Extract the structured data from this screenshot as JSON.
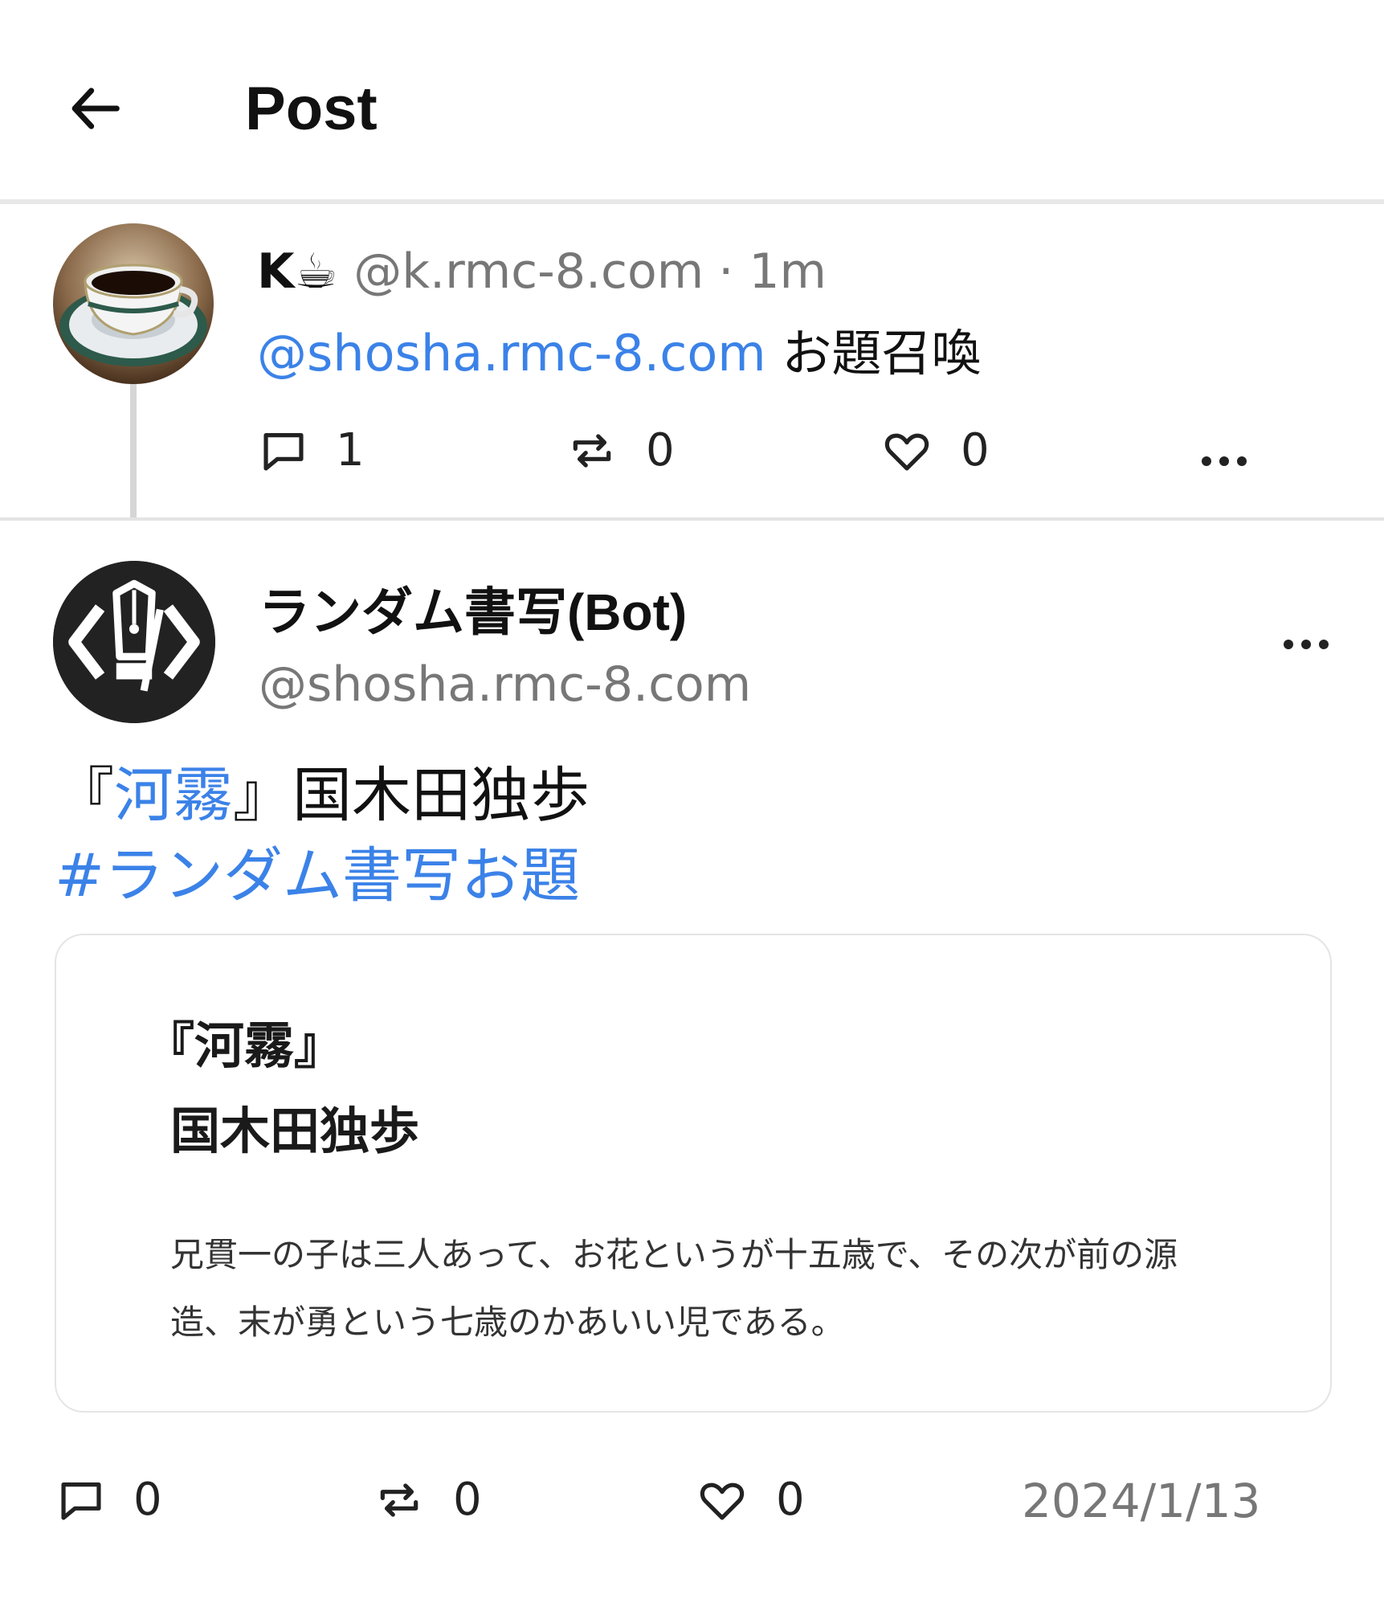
{
  "header": {
    "title": "Post"
  },
  "reply_post": {
    "display_name": "K☕",
    "handle": "@k.rmc-8.com",
    "time": "· 1m",
    "mention": "@shosha.rmc-8.com",
    "text": " お題召喚",
    "replies": "1",
    "reposts": "0",
    "likes": "0"
  },
  "main_post": {
    "display_name": "ランダム書写(Bot)",
    "handle": "@shosha.rmc-8.com",
    "body_open": "『",
    "body_title_link": "河霧",
    "body_rest": "』国木田独歩",
    "hashtag": "#ランダム書写お題",
    "embed": {
      "title": "『河霧』",
      "author": "国木田独歩",
      "text": "兄貫一の子は三人あって、お花というが十五歳で、その次が前の源造、末が勇という七歳のかあいい児である。"
    },
    "replies": "0",
    "reposts": "0",
    "likes": "0",
    "date": "2024/1/13"
  },
  "icons": {
    "back": "arrow-left-icon",
    "reply": "comment-icon",
    "repost": "repost-icon",
    "like": "heart-icon",
    "more": "more-dots-icon"
  },
  "colors": {
    "link": "#3b82e8",
    "muted": "#777777",
    "border": "#e5e5e5"
  }
}
